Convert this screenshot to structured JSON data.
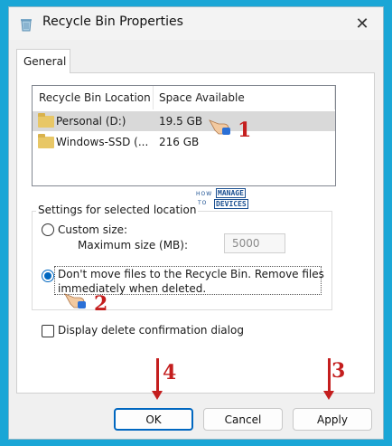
{
  "window": {
    "title": "Recycle Bin Properties",
    "close_label": "✕"
  },
  "tabs": [
    {
      "label": "General",
      "selected": true
    }
  ],
  "locations": {
    "columns": [
      "Recycle Bin Location",
      "Space Available"
    ],
    "rows": [
      {
        "name": "Personal (D:)",
        "space": "19.5 GB",
        "selected": true
      },
      {
        "name": "Windows-SSD (...",
        "space": "216 GB",
        "selected": false
      }
    ]
  },
  "settings": {
    "group_label": "Settings for selected location",
    "custom_size_label": "Custom size:",
    "max_size_label": "Maximum size (MB):",
    "max_size_value": "5000",
    "dont_move_line1": "Don't move files to the Recycle Bin. Remove files",
    "dont_move_line2": "immediately when deleted.",
    "selected_option": "dont_move"
  },
  "confirm_dialog_label": "Display delete confirmation dialog",
  "confirm_dialog_checked": false,
  "buttons": {
    "ok": "OK",
    "cancel": "Cancel",
    "apply": "Apply"
  },
  "annotations": {
    "step1": "1",
    "step2": "2",
    "step3": "3",
    "step4": "4"
  },
  "watermark": {
    "how": "HOW",
    "to": "TO",
    "manage": "MANAGE",
    "devices": "DEVICES"
  },
  "colors": {
    "accent": "#0067c0",
    "annotation": "#c41e1e",
    "background": "#1aa6d6"
  }
}
